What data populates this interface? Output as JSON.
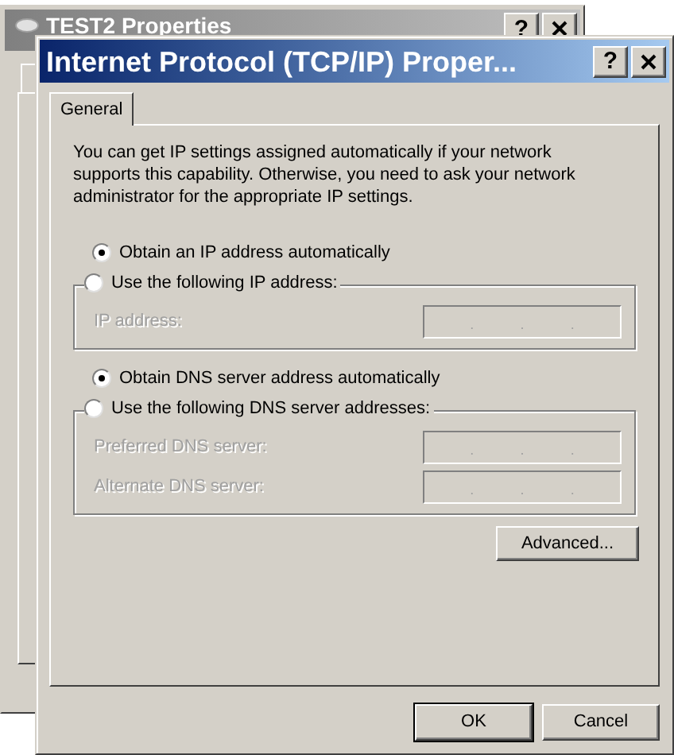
{
  "background_window": {
    "title": "TEST2 Properties",
    "help_button": "?"
  },
  "dialog": {
    "title": "Internet Protocol (TCP/IP) Proper...",
    "help_button": "?",
    "tabs": [
      {
        "label": "General",
        "selected": true
      }
    ],
    "intro": "You can get IP settings assigned automatically if your network supports this capability. Otherwise, you need to ask your network administrator for the appropriate IP settings.",
    "ip_options": [
      {
        "label": "Obtain an IP address automatically",
        "selected": true
      },
      {
        "label": "Use the following IP address:",
        "selected": false
      }
    ],
    "ip_fields": [
      {
        "label": "IP address:",
        "disabled": true,
        "separators": [
          ".",
          ".",
          "."
        ]
      }
    ],
    "dns_options": [
      {
        "label": "Obtain DNS server address automatically",
        "selected": true
      },
      {
        "label": "Use the following DNS server addresses:",
        "selected": false
      }
    ],
    "dns_fields": [
      {
        "label": "Preferred DNS server:",
        "disabled": true,
        "separators": [
          ".",
          ".",
          "."
        ]
      },
      {
        "label": "Alternate DNS server:",
        "disabled": true,
        "separators": [
          ".",
          ".",
          "."
        ]
      }
    ],
    "advanced_button": "Advanced...",
    "buttons": [
      {
        "label": "OK",
        "default": true
      },
      {
        "label": "Cancel",
        "default": false
      }
    ]
  }
}
